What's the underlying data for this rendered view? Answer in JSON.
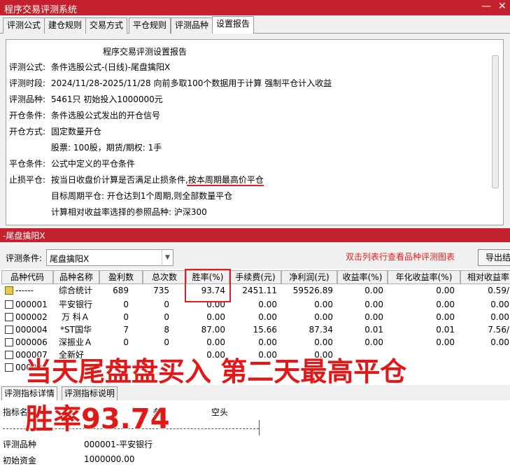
{
  "window": {
    "title": "程序交易评测系统",
    "min_icon": "—",
    "close_icon": "✕"
  },
  "tabs": [
    {
      "label": "评测公式"
    },
    {
      "label": "建仓规则"
    },
    {
      "label": "交易方式"
    },
    {
      "label": "平仓规则"
    },
    {
      "label": "评测品种"
    },
    {
      "label": "设置报告"
    }
  ],
  "report": {
    "title": "程序交易评测设置报告",
    "lines": [
      {
        "key": "评测公式:",
        "value": "条件选股公式-(日线)-尾盘擒阳X"
      },
      {
        "key": "评测时段:",
        "value": "2024/11/28-2025/11/28 向前多取100个数据用于计算 强制平仓计入收益"
      },
      {
        "key": "评测品种:",
        "value": "5461只 初始投入1000000元"
      },
      {
        "key": "开仓条件:",
        "value": "条件选股公式发出的开仓信号"
      },
      {
        "key": "开仓方式:",
        "value": "固定数量开仓"
      },
      {
        "key": "",
        "value": "股票: 100股，期货/期权: 1手"
      },
      {
        "key": "平仓条件:",
        "value": "公式中定义的平仓条件"
      },
      {
        "key": "止损平仓:",
        "value": "按当日收盘价计算是否满足止损条件,按本周期最高价平仓"
      },
      {
        "key": "",
        "value": "目标周期平仓: 开仓达到1个周期,则全部数量平仓"
      },
      {
        "key": "",
        "value": "计算相对收益率选择的参照品种: 沪深300"
      }
    ]
  },
  "section2": {
    "title": "-尾盘擒阳X",
    "condition_label": "评测条件:",
    "condition_value": "尾盘擒阳X",
    "hint": "双击列表行查看品种评测图表",
    "export_label": "导出结"
  },
  "table": {
    "headers": [
      "品种代码",
      "品种名称",
      "盈利数",
      "总次数",
      "胜率(%)",
      "手续费(元)",
      "净利润(元)",
      "收益率(%)",
      "年化收益率(%)",
      "相对收益率"
    ],
    "rows": [
      {
        "code": "------",
        "name": "综合统计",
        "profit": "689",
        "total": "735",
        "win": "93.74",
        "fee": "2451.11",
        "net": "59526.89",
        "ret": "0.00",
        "annual": "0.00",
        "rel": "0.59/"
      },
      {
        "code": "000001",
        "name": "平安银行",
        "profit": "0",
        "total": "0",
        "win": "0.00",
        "fee": "0.00",
        "net": "0.00",
        "ret": "0.00",
        "annual": "0.00",
        "rel": "0.00"
      },
      {
        "code": "000002",
        "name": "万 科Ａ",
        "profit": "0",
        "total": "0",
        "win": "0.00",
        "fee": "0.00",
        "net": "0.00",
        "ret": "0.00",
        "annual": "0.00",
        "rel": "0.00"
      },
      {
        "code": "000004",
        "name": "*ST国华",
        "profit": "7",
        "total": "8",
        "win": "87.00",
        "fee": "15.66",
        "net": "87.34",
        "ret": "0.01",
        "annual": "0.01",
        "rel": "7.56/"
      },
      {
        "code": "000006",
        "name": "深振业Ａ",
        "profit": "0",
        "total": "0",
        "win": "0.00",
        "fee": "0.00",
        "net": "0.00",
        "ret": "0.00",
        "annual": "0.00",
        "rel": "0.00"
      },
      {
        "code": "000007",
        "name": "全新好",
        "profit": "0",
        "total": "0",
        "win": "0.00",
        "fee": "0.00",
        "net": "0.00",
        "ret": "0.00",
        "annual": "0.00",
        "rel": "0.00"
      },
      {
        "code": "000008",
        "name": "神州高铁",
        "profit": "0",
        "total": "0",
        "win": "0.00",
        "fee": "0.00",
        "net": "0.00",
        "ret": "0.00",
        "annual": "0.00",
        "rel": "0.00"
      }
    ]
  },
  "bottom_tabs": [
    {
      "label": "评测指标详情"
    },
    {
      "label": "评测指标说明"
    }
  ],
  "bottom": {
    "col_header": "指标名",
    "col_header2": "多",
    "col_short": "空头",
    "rows": [
      {
        "key": "评测品种",
        "value": "000001-平安银行"
      },
      {
        "key": "初始资金",
        "value": "1000000.00"
      }
    ]
  },
  "overlay": {
    "line1": "当天尾盘盘买入 第二天最高平仓",
    "line2": "胜率93.74"
  },
  "colors": {
    "accent_red": "#c4202e",
    "highlight_red": "#e02020"
  }
}
